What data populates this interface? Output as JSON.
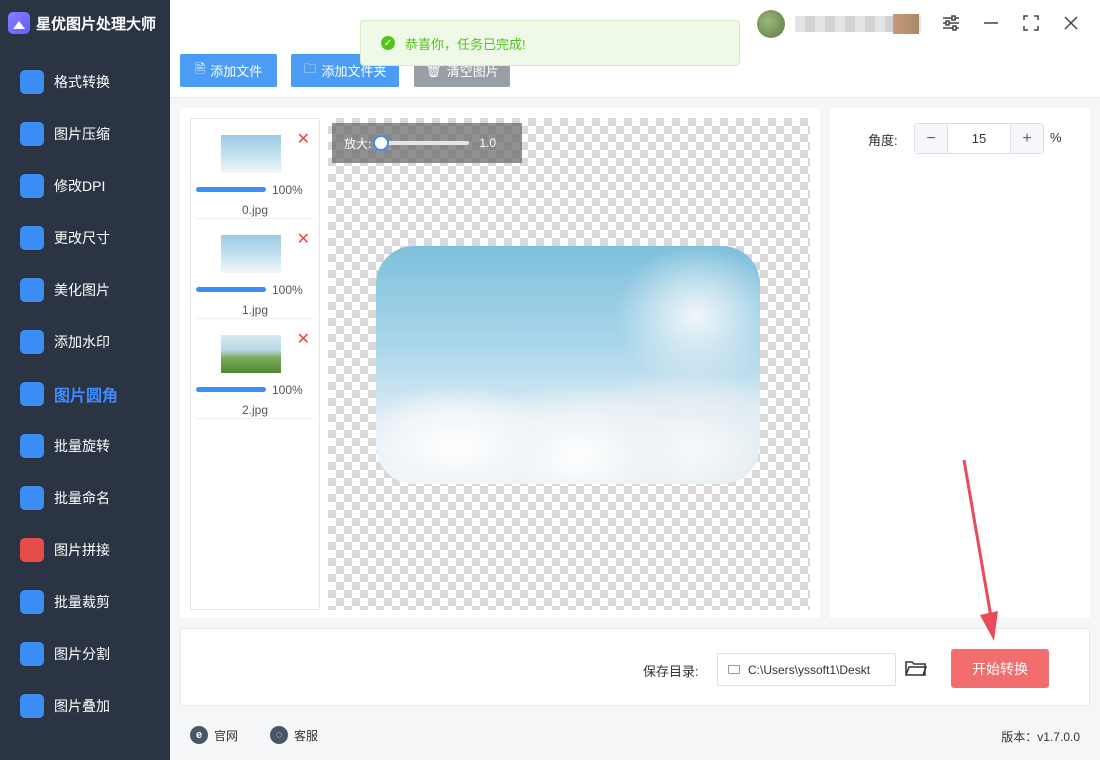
{
  "app": {
    "title": "星优图片处理大师"
  },
  "sidebar": {
    "items": [
      {
        "label": "格式转换",
        "icon": "image-convert-icon",
        "color": "#3a8ef6"
      },
      {
        "label": "图片压缩",
        "icon": "compress-icon",
        "color": "#3a8ef6"
      },
      {
        "label": "修改DPI",
        "icon": "dpi-icon",
        "color": "#3a8ef6"
      },
      {
        "label": "更改尺寸",
        "icon": "resize-icon",
        "color": "#3a8ef6"
      },
      {
        "label": "美化图片",
        "icon": "beautify-icon",
        "color": "#3a8ef6"
      },
      {
        "label": "添加水印",
        "icon": "watermark-icon",
        "color": "#3a8ef6"
      },
      {
        "label": "图片圆角",
        "icon": "round-corner-icon",
        "color": "#3a8ef6",
        "active": true
      },
      {
        "label": "批量旋转",
        "icon": "rotate-icon",
        "color": "#3a8ef6"
      },
      {
        "label": "批量命名",
        "icon": "rename-icon",
        "color": "#3a8ef6"
      },
      {
        "label": "图片拼接",
        "icon": "puzzle-icon",
        "color": "#e84b4b"
      },
      {
        "label": "批量裁剪",
        "icon": "crop-icon",
        "color": "#3a8ef6"
      },
      {
        "label": "图片分割",
        "icon": "split-icon",
        "color": "#3a8ef6"
      },
      {
        "label": "图片叠加",
        "icon": "layers-icon",
        "color": "#3a8ef6"
      }
    ]
  },
  "toast": {
    "message": "恭喜你，任务已完成!",
    "color": "#52c41a"
  },
  "toolbar": {
    "add_file": "添加文件",
    "add_folder": "添加文件夹",
    "clear_images": "清空图片"
  },
  "files": [
    {
      "name": "0.jpg",
      "progress": "100%",
      "thumb": "sky"
    },
    {
      "name": "1.jpg",
      "progress": "100%",
      "thumb": "sky"
    },
    {
      "name": "2.jpg",
      "progress": "100%",
      "thumb": "land"
    }
  ],
  "zoom": {
    "label": "放大:",
    "value": "1.0"
  },
  "settings": {
    "angle_label": "角度:",
    "angle_value": "15",
    "unit": "%"
  },
  "save": {
    "label": "保存目录:",
    "path": "C:\\Users\\yssoft1\\Deskt",
    "start_button": "开始转换",
    "start_color": "#f26d6d"
  },
  "footer": {
    "official_site": "官网",
    "support": "客服",
    "version": "版本：v1.7.0.0"
  }
}
